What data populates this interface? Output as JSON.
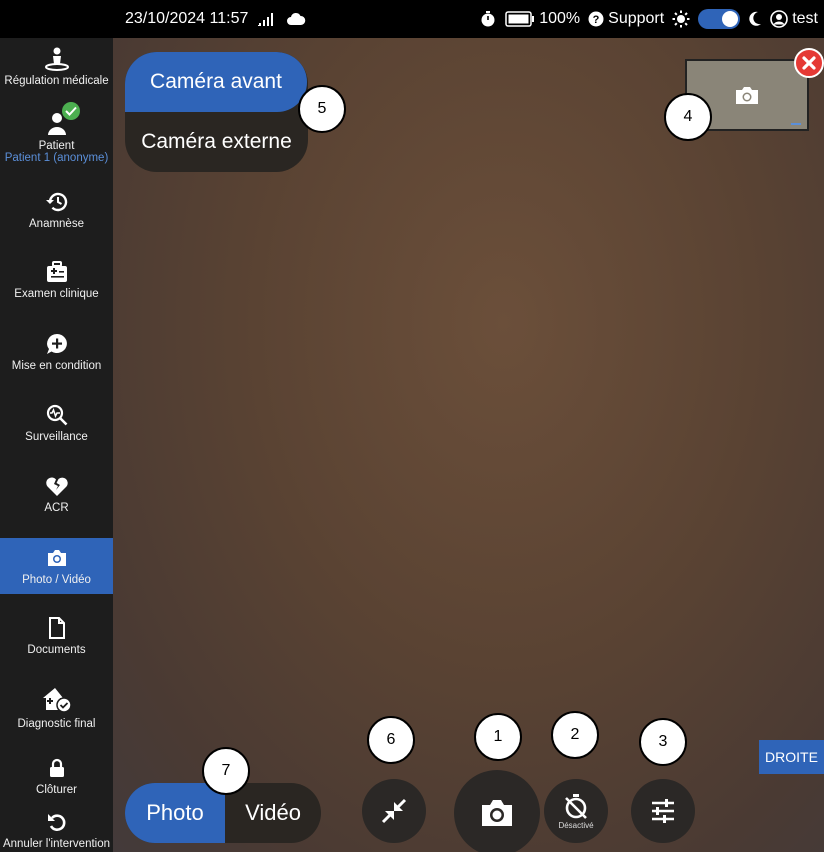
{
  "status_bar": {
    "datetime": "23/10/2024 11:57",
    "battery": "100%",
    "support_label": "Support",
    "user_name": "test",
    "icons": [
      "signal-icon",
      "cloud-icon",
      "stopwatch-icon",
      "battery-icon",
      "help-icon",
      "sun-icon",
      "moon-icon",
      "user-icon"
    ]
  },
  "sidebar": {
    "items": [
      {
        "label": "Régulation médicale",
        "icon": "medical-regulation-icon"
      },
      {
        "label": "Patient",
        "sub": "Patient 1 (anonyme)",
        "icon": "patient-icon",
        "badge": "check-icon"
      },
      {
        "label": "Anamnèse",
        "icon": "history-icon"
      },
      {
        "label": "Examen clinique",
        "icon": "medical-kit-icon"
      },
      {
        "label": "Mise en condition",
        "icon": "chat-plus-icon"
      },
      {
        "label": "Surveillance",
        "icon": "monitor-search-icon"
      },
      {
        "label": "ACR",
        "icon": "broken-heart-icon"
      },
      {
        "label": "Photo / Vidéo",
        "icon": "camera-icon",
        "active": true
      },
      {
        "label": "Documents",
        "icon": "document-icon"
      },
      {
        "label": "Diagnostic final",
        "icon": "house-check-icon"
      },
      {
        "label": "Clôturer",
        "icon": "lock-icon"
      },
      {
        "label": "Annuler l'intervention",
        "icon": "undo-icon"
      }
    ]
  },
  "camera": {
    "front_label": "Caméra avant",
    "external_label": "Caméra externe",
    "mode_photo": "Photo",
    "mode_video": "Vidéo",
    "timer_label": "Désactivé",
    "side_label": "DROITE"
  },
  "callouts": [
    "1",
    "2",
    "3",
    "4",
    "5",
    "6",
    "7"
  ],
  "colors": {
    "accent": "#2f64b8",
    "sidebar": "#1d1d1d",
    "close": "#e53935",
    "success": "#4caf50"
  }
}
